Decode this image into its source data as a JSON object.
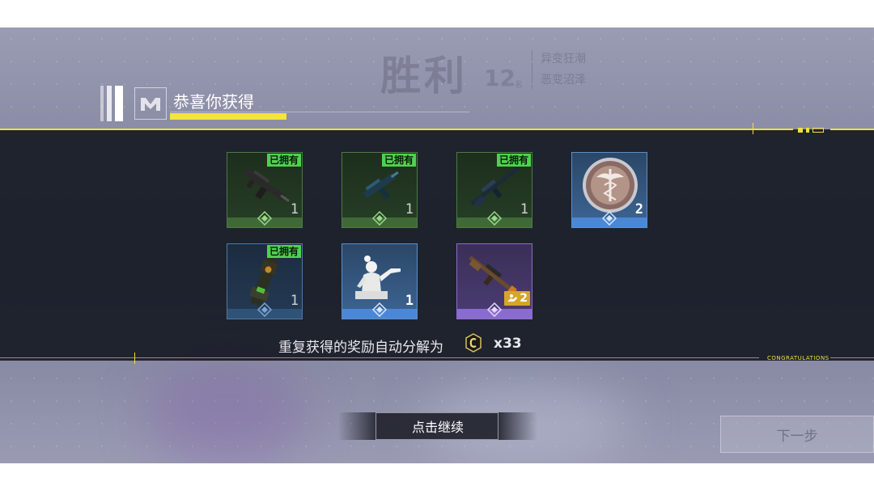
{
  "background": {
    "result_title": "胜利",
    "rank": "12",
    "rank_unit": "名",
    "mode": "异变狂潮",
    "map": "恶变沼泽"
  },
  "header": {
    "title": "恭喜你获得"
  },
  "rewards": [
    {
      "name": "weapon-skin-1",
      "rarity": "green",
      "owned_badge": "已拥有",
      "quantity": "1"
    },
    {
      "name": "weapon-skin-2",
      "rarity": "green",
      "owned_badge": "已拥有",
      "quantity": "1"
    },
    {
      "name": "weapon-skin-3",
      "rarity": "green",
      "owned_badge": "已拥有",
      "quantity": "1"
    },
    {
      "name": "medic-emblem",
      "rarity": "blue-light",
      "owned_badge": "",
      "quantity": "2"
    },
    {
      "name": "weapon-skin-4",
      "rarity": "blue",
      "owned_badge": "已拥有",
      "quantity": "1"
    },
    {
      "name": "emote-statue",
      "rarity": "blue-light",
      "owned_badge": "",
      "quantity": "1"
    },
    {
      "name": "weapon-skin-5",
      "rarity": "purple",
      "owned_badge": "",
      "quantity": "2"
    }
  ],
  "duplicate": {
    "text": "重复获得的奖励自动分解为",
    "currency_icon": "c-coin-icon",
    "amount": "x33"
  },
  "banner_label": "CONGRATULATIONS",
  "buttons": {
    "continue": "点击继续",
    "next": "下一步"
  },
  "colors": {
    "accent_yellow": "#f1e03a",
    "owned_green": "#4fd24f",
    "rarity_green": "#3f6a38",
    "rarity_blue": "#4a88d6",
    "rarity_purple": "#8a6ccf",
    "gold": "#d4a62a"
  }
}
